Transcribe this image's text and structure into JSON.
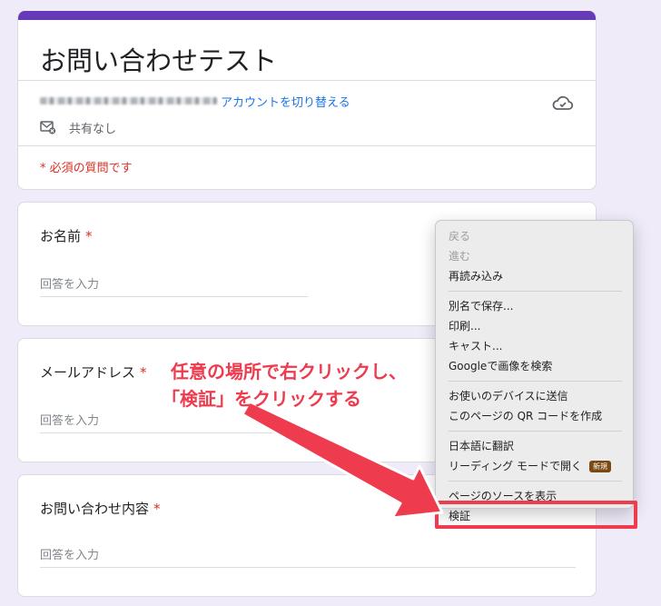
{
  "form": {
    "title": "お問い合わせテスト",
    "switch_account": "アカウントを切り替える",
    "share_status": "共有なし",
    "required_note": "* 必須の質問です"
  },
  "questions": [
    {
      "label": "お名前",
      "required": "*",
      "placeholder": "回答を入力"
    },
    {
      "label": "メールアドレス",
      "required": "*",
      "placeholder": "回答を入力"
    },
    {
      "label": "お問い合わせ内容",
      "required": "*",
      "placeholder": "回答を入力"
    }
  ],
  "context_menu": {
    "items": [
      "戻る",
      "進む",
      "再読み込み",
      "別名で保存...",
      "印刷...",
      "キャスト...",
      "Googleで画像を検索",
      "お使いのデバイスに送信",
      "このページの QR コードを作成",
      "日本語に翻訳",
      "リーディング モードで開く",
      "ページのソースを表示",
      "検証"
    ],
    "new_badge": "新規"
  },
  "annotation": {
    "line1": "任意の場所で右クリックし、",
    "line2": "「検証」をクリックする"
  },
  "icons": {
    "cloud": "cloud-saved-icon",
    "share": "mail-not-shared-icon",
    "arrow": "arrow-icon"
  },
  "colors": {
    "accent": "#673ab7",
    "link": "#1a73e8",
    "required": "#d93025",
    "annotation": "#ef3b4e"
  }
}
